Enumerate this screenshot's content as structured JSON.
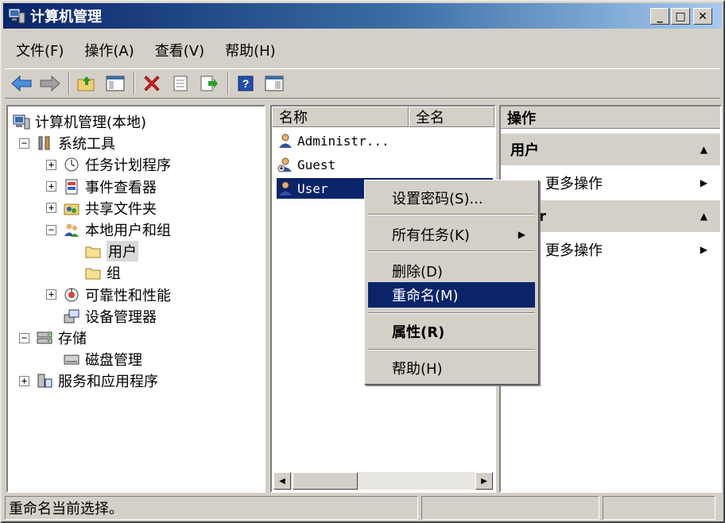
{
  "window": {
    "title": "计算机管理"
  },
  "menu": [
    "文件(F)",
    "操作(A)",
    "查看(V)",
    "帮助(H)"
  ],
  "toolbar": [
    "back-arrow-icon",
    "forward-arrow-icon",
    "up-folder-icon",
    "show-hide-tree-icon",
    "delete-icon",
    "properties-icon",
    "export-list-icon",
    "help-icon",
    "console-tree-icon"
  ],
  "tree": [
    {
      "label": "计算机管理(本地)",
      "level": 0,
      "expander": "",
      "icon": "computer-icon"
    },
    {
      "label": "系统工具",
      "level": 1,
      "expander": "−",
      "icon": "tools-icon"
    },
    {
      "label": "任务计划程序",
      "level": 2,
      "expander": "+",
      "icon": "clock-icon"
    },
    {
      "label": "事件查看器",
      "level": 2,
      "expander": "+",
      "icon": "event-viewer-icon"
    },
    {
      "label": "共享文件夹",
      "level": 2,
      "expander": "+",
      "icon": "shared-folder-icon"
    },
    {
      "label": "本地用户和组",
      "level": 2,
      "expander": "−",
      "icon": "users-groups-icon"
    },
    {
      "label": "用户",
      "level": 3,
      "expander": "",
      "icon": "folder-icon",
      "selected": true
    },
    {
      "label": "组",
      "level": 3,
      "expander": "",
      "icon": "folder-icon"
    },
    {
      "label": "可靠性和性能",
      "level": 2,
      "expander": "+",
      "icon": "performance-icon"
    },
    {
      "label": "设备管理器",
      "level": 2,
      "expander": "",
      "icon": "device-manager-icon"
    },
    {
      "label": "存储",
      "level": 1,
      "expander": "−",
      "icon": "storage-icon"
    },
    {
      "label": "磁盘管理",
      "level": 2,
      "expander": "",
      "icon": "disk-icon"
    },
    {
      "label": "服务和应用程序",
      "level": 1,
      "expander": "+",
      "icon": "services-icon"
    }
  ],
  "list": {
    "columns": [
      "名称",
      "全名"
    ],
    "rows": [
      {
        "name": "Administr...",
        "icon": "user-icon"
      },
      {
        "name": "Guest",
        "icon": "user-disabled-icon"
      },
      {
        "name": "User",
        "icon": "user-icon",
        "selected": true
      }
    ]
  },
  "actions": {
    "header": "操作",
    "sections": [
      {
        "title": "用户",
        "item": "更多操作"
      },
      {
        "title": "r",
        "item": "更多操作"
      }
    ]
  },
  "context_menu": {
    "items": [
      {
        "label": "设置密码(S)...",
        "type": "item"
      },
      {
        "type": "sep"
      },
      {
        "label": "所有任务(K)",
        "type": "item",
        "submenu": true
      },
      {
        "type": "sep"
      },
      {
        "label": "删除(D)",
        "type": "item"
      },
      {
        "label": "重命名(M)",
        "type": "item",
        "highlighted": true
      },
      {
        "type": "sep"
      },
      {
        "label": "属性(R)",
        "type": "item",
        "bold": true
      },
      {
        "type": "sep"
      },
      {
        "label": "帮助(H)",
        "type": "item"
      }
    ]
  },
  "status": {
    "text": "重命名当前选择。"
  }
}
